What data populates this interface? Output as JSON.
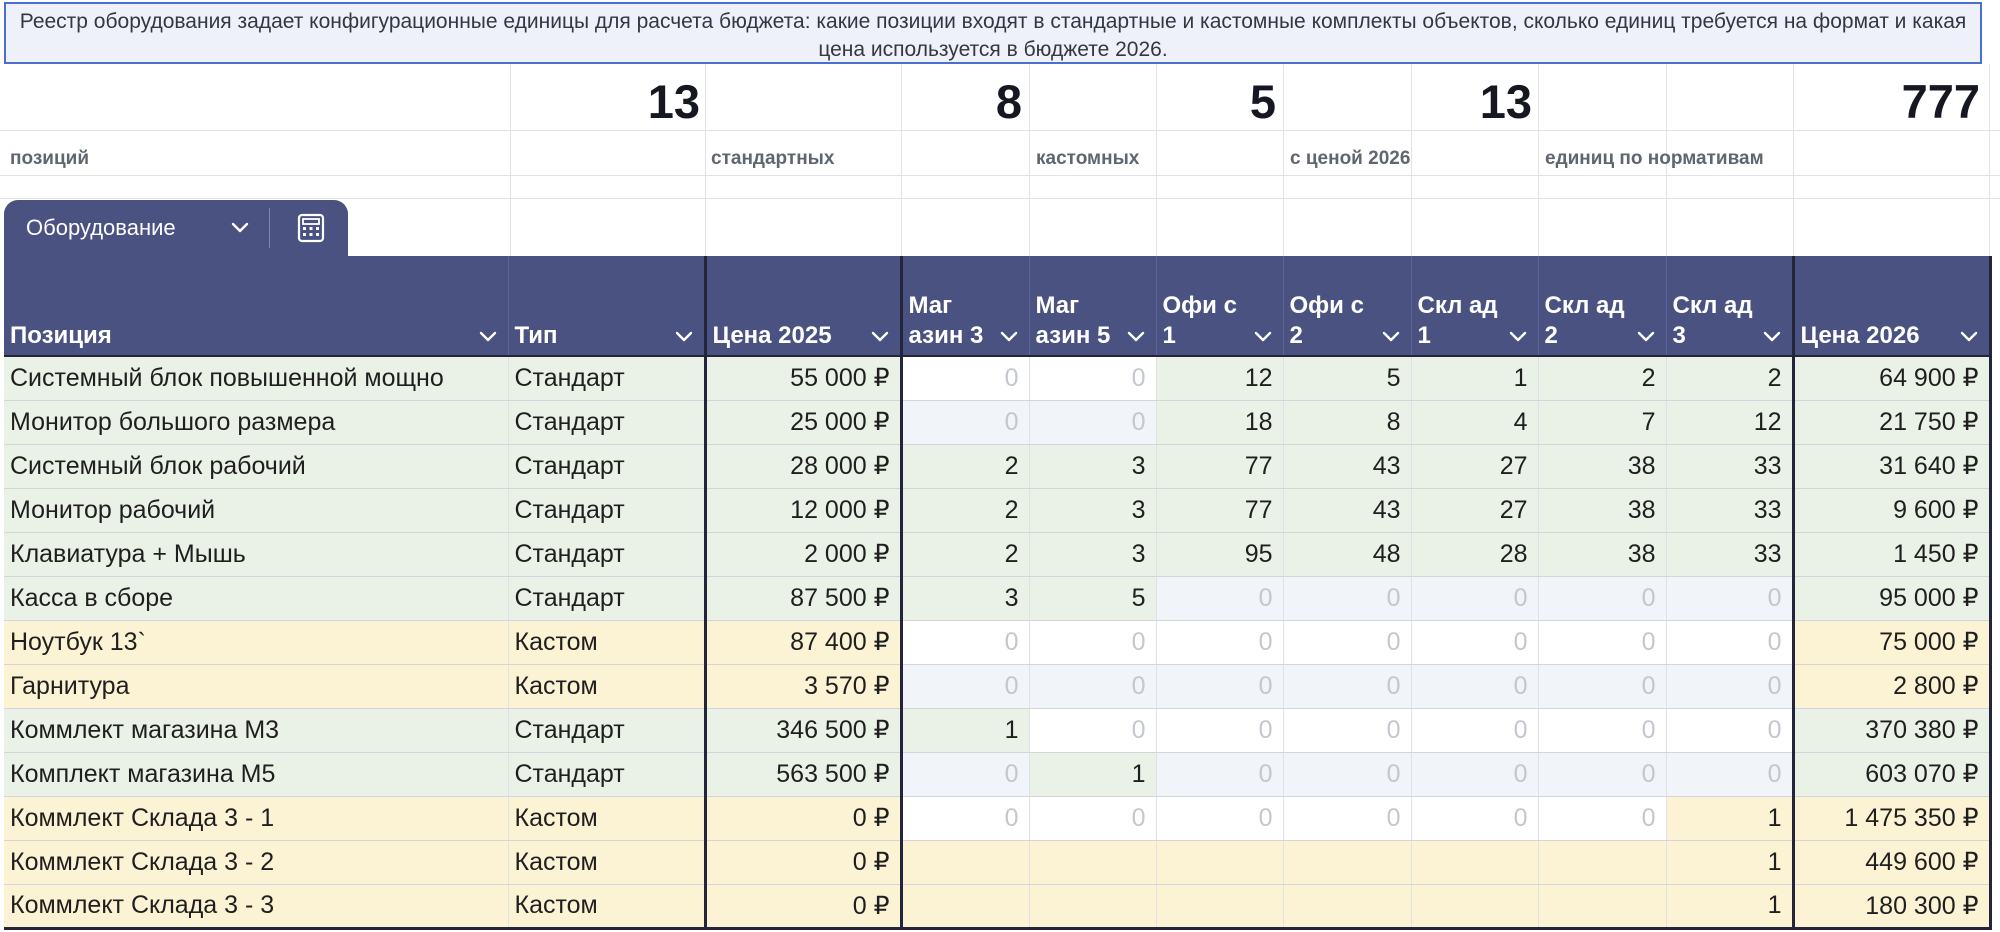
{
  "description": "Реестр оборудования задает конфигурационные единицы для расчета бюджета: какие позиции входят в стандартные и кастомные комплекты объектов, сколько единиц требуется на формат и какая цена используется в бюджете 2026.",
  "kpis": [
    {
      "value": "13",
      "label": "позиций"
    },
    {
      "value": "8",
      "label": "стандартных"
    },
    {
      "value": "5",
      "label": "кастомных"
    },
    {
      "value": "13",
      "label": "с ценой 2026"
    },
    {
      "value": "777",
      "label": "единиц по нормативам"
    }
  ],
  "tab": {
    "label": "Оборудование",
    "icons": [
      "chevron-down-icon",
      "calculator-icon"
    ]
  },
  "columns": [
    "Позиция",
    "Тип",
    "Цена 2025",
    "Маг азин 3",
    "Маг азин 5",
    "Офи с 1",
    "Офи с 2",
    "Скл ад 1",
    "Скл ад 2",
    "Скл ад 3",
    "Цена 2026"
  ],
  "rows": [
    {
      "name": "Системный блок повышенной мощно",
      "type": "Стандарт",
      "price2025": "55 000 ₽",
      "m3": "0",
      "m5": "0",
      "o1": "12",
      "o2": "5",
      "s1": "1",
      "s2": "2",
      "s3": "2",
      "price2026": "64 900 ₽"
    },
    {
      "name": "Монитор большого размера",
      "type": "Стандарт",
      "price2025": "25 000 ₽",
      "m3": "0",
      "m5": "0",
      "o1": "18",
      "o2": "8",
      "s1": "4",
      "s2": "7",
      "s3": "12",
      "price2026": "21 750 ₽"
    },
    {
      "name": "Системный блок рабочий",
      "type": "Стандарт",
      "price2025": "28 000 ₽",
      "m3": "2",
      "m5": "3",
      "o1": "77",
      "o2": "43",
      "s1": "27",
      "s2": "38",
      "s3": "33",
      "price2026": "31 640 ₽"
    },
    {
      "name": "Монитор рабочий",
      "type": "Стандарт",
      "price2025": "12 000 ₽",
      "m3": "2",
      "m5": "3",
      "o1": "77",
      "o2": "43",
      "s1": "27",
      "s2": "38",
      "s3": "33",
      "price2026": "9 600 ₽"
    },
    {
      "name": "Клавиатура + Мышь",
      "type": "Стандарт",
      "price2025": "2 000 ₽",
      "m3": "2",
      "m5": "3",
      "o1": "95",
      "o2": "48",
      "s1": "28",
      "s2": "38",
      "s3": "33",
      "price2026": "1 450 ₽"
    },
    {
      "name": "Касса в сборе",
      "type": "Стандарт",
      "price2025": "87 500 ₽",
      "m3": "3",
      "m5": "5",
      "o1": "0",
      "o2": "0",
      "s1": "0",
      "s2": "0",
      "s3": "0",
      "price2026": "95 000 ₽"
    },
    {
      "name": "Ноутбук 13`",
      "type": "Кастом",
      "price2025": "87 400 ₽",
      "m3": "0",
      "m5": "0",
      "o1": "0",
      "o2": "0",
      "s1": "0",
      "s2": "0",
      "s3": "0",
      "price2026": "75 000 ₽"
    },
    {
      "name": "Гарнитура",
      "type": "Кастом",
      "price2025": "3 570 ₽",
      "m3": "0",
      "m5": "0",
      "o1": "0",
      "o2": "0",
      "s1": "0",
      "s2": "0",
      "s3": "0",
      "price2026": "2 800 ₽"
    },
    {
      "name": "Коммлект магазина М3",
      "type": "Стандарт",
      "price2025": "346 500 ₽",
      "m3": "1",
      "m5": "0",
      "o1": "0",
      "o2": "0",
      "s1": "0",
      "s2": "0",
      "s3": "0",
      "price2026": "370 380 ₽"
    },
    {
      "name": "Комплект магазина М5",
      "type": "Стандарт",
      "price2025": "563 500 ₽",
      "m3": "0",
      "m5": "1",
      "o1": "0",
      "o2": "0",
      "s1": "0",
      "s2": "0",
      "s3": "0",
      "price2026": "603 070 ₽"
    },
    {
      "name": "Коммлект Склада 3 - 1",
      "type": "Кастом",
      "price2025": "0 ₽",
      "m3": "0",
      "m5": "0",
      "o1": "0",
      "o2": "0",
      "s1": "0",
      "s2": "0",
      "s3": "1",
      "price2026": "1 475 350 ₽"
    },
    {
      "name": "Коммлект Склада 3 - 2",
      "type": "Кастом",
      "price2025": "0 ₽",
      "m3": "",
      "m5": "",
      "o1": "",
      "o2": "",
      "s1": "",
      "s2": "",
      "s3": "1",
      "price2026": "449 600 ₽"
    },
    {
      "name": "Коммлект Склада 3 - 3",
      "type": "Кастом",
      "price2025": "0 ₽",
      "m3": "",
      "m5": "",
      "o1": "",
      "o2": "",
      "s1": "",
      "s2": "",
      "s3": "1",
      "price2026": "180 300 ₽"
    }
  ],
  "colors": {
    "header": "#4a5282",
    "standard_row": "#eaf1e6",
    "custom_row": "#fcf2d4",
    "banner_border": "#4a6fd0"
  }
}
